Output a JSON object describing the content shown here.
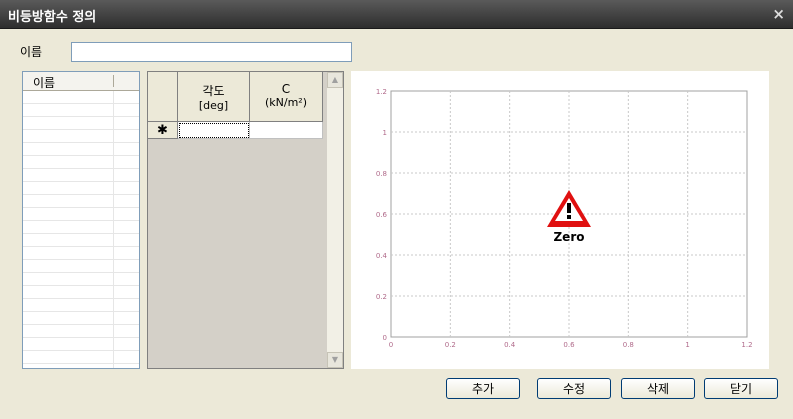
{
  "window": {
    "title": "비등방함수 정의",
    "close": "×"
  },
  "form": {
    "name_label": "이름",
    "name_value": ""
  },
  "list": {
    "header": "이름",
    "items": []
  },
  "grid": {
    "columns": [
      {
        "line1": "각도",
        "line2": "[deg]"
      },
      {
        "line1": "C",
        "line2": "(kN/m²)"
      }
    ],
    "new_row_marker": "✱"
  },
  "chart_data": {
    "type": "line",
    "series": [],
    "xlim": [
      0,
      1.2
    ],
    "ylim": [
      0,
      1.2
    ],
    "x_ticks": [
      "0",
      "0.2",
      "0.4",
      "0.6",
      "0.8",
      "1",
      "1.2"
    ],
    "y_ticks": [
      "0",
      "0.2",
      "0.4",
      "0.6",
      "0.8",
      "1",
      "1.2"
    ],
    "grid": true,
    "annotation": "Zero",
    "colors": {
      "tick": "#b06a8a",
      "grid": "#c8c8c8",
      "warning_red": "#e01010"
    }
  },
  "buttons": {
    "add": "추가",
    "edit": "수정",
    "delete": "삭제",
    "close": "닫기"
  }
}
